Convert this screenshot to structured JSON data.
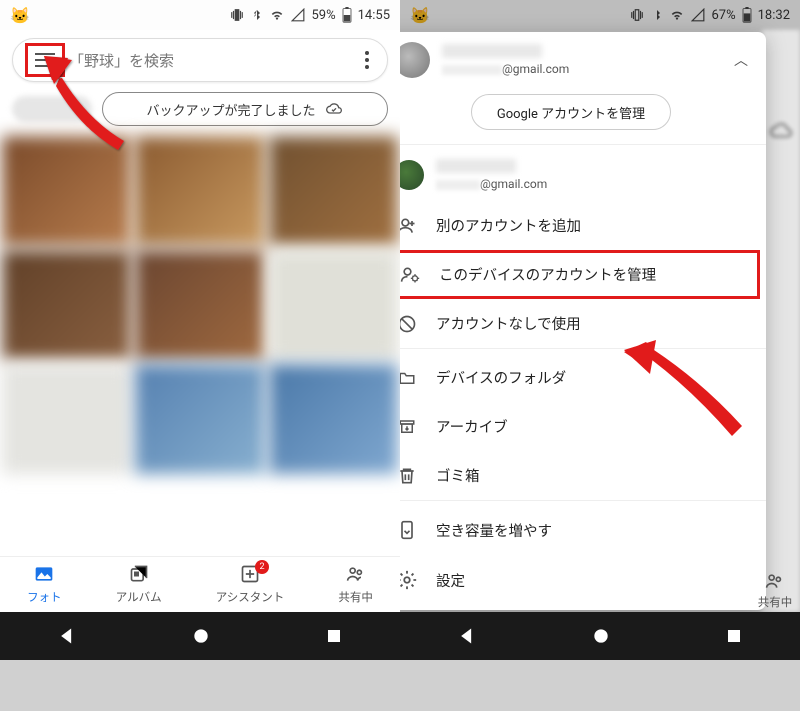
{
  "left": {
    "status": {
      "battery": "59%",
      "time": "14:55"
    },
    "search_placeholder": "「野球」を検索",
    "backup_chip": "バックアップが完了しました",
    "tabs": {
      "photos": "フォト",
      "albums": "アルバム",
      "assistant": "アシスタント",
      "assistant_badge": "2",
      "sharing": "共有中"
    }
  },
  "right": {
    "status": {
      "battery": "67%",
      "time": "18:32"
    },
    "primary_email_suffix": "@gmail.com",
    "manage_account_btn": "Google アカウントを管理",
    "secondary_email_suffix": "@gmail.com",
    "menu": {
      "add_account": "別のアカウントを追加",
      "manage_device_accounts": "このデバイスのアカウントを管理",
      "use_without_account": "アカウントなしで使用",
      "device_folders": "デバイスのフォルダ",
      "archive": "アーカイブ",
      "trash": "ゴミ箱",
      "free_space": "空き容量を増やす",
      "settings": "設定"
    },
    "ghost_tab_sharing": "共有中"
  }
}
